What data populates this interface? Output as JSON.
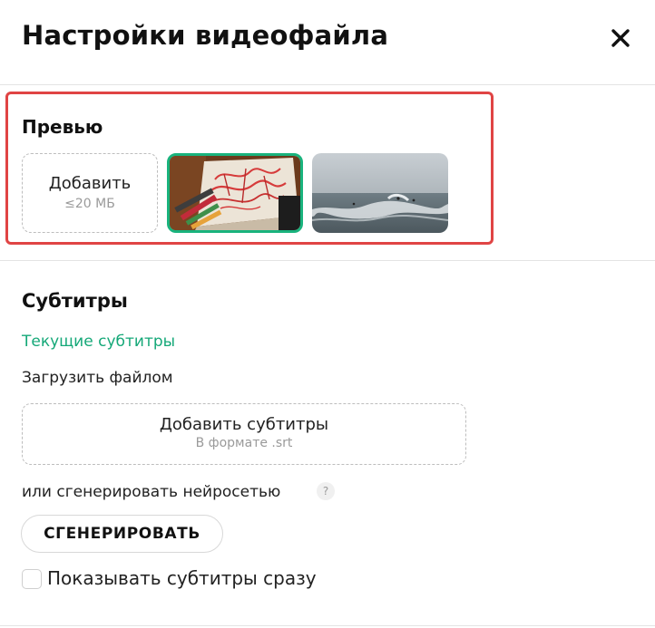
{
  "header": {
    "title": "Настройки видеофайла",
    "close_icon": "close-icon"
  },
  "preview": {
    "title": "Превью",
    "add_tile": {
      "label": "Добавить",
      "limit": "≤20 МБ"
    },
    "thumbnails": [
      {
        "name": "calligraphy-thumbnail",
        "selected": true
      },
      {
        "name": "sea-surf-thumbnail",
        "selected": false
      }
    ]
  },
  "subtitles": {
    "title": "Субтитры",
    "current_link": "Текущие субтитры",
    "upload_label": "Загрузить файлом",
    "drop_zone": {
      "label": "Добавить субтитры",
      "hint": "В формате .srt"
    },
    "generate_label": "или сгенерировать нейросетью",
    "help_icon_text": "?",
    "generate_button": "СГЕНЕРИРОВАТЬ",
    "show_checkbox": {
      "label": "Показывать субтитры сразу",
      "checked": false
    }
  },
  "colors": {
    "accent_green": "#19b37d",
    "highlight_red": "#e04444",
    "link_green": "#15a878"
  }
}
